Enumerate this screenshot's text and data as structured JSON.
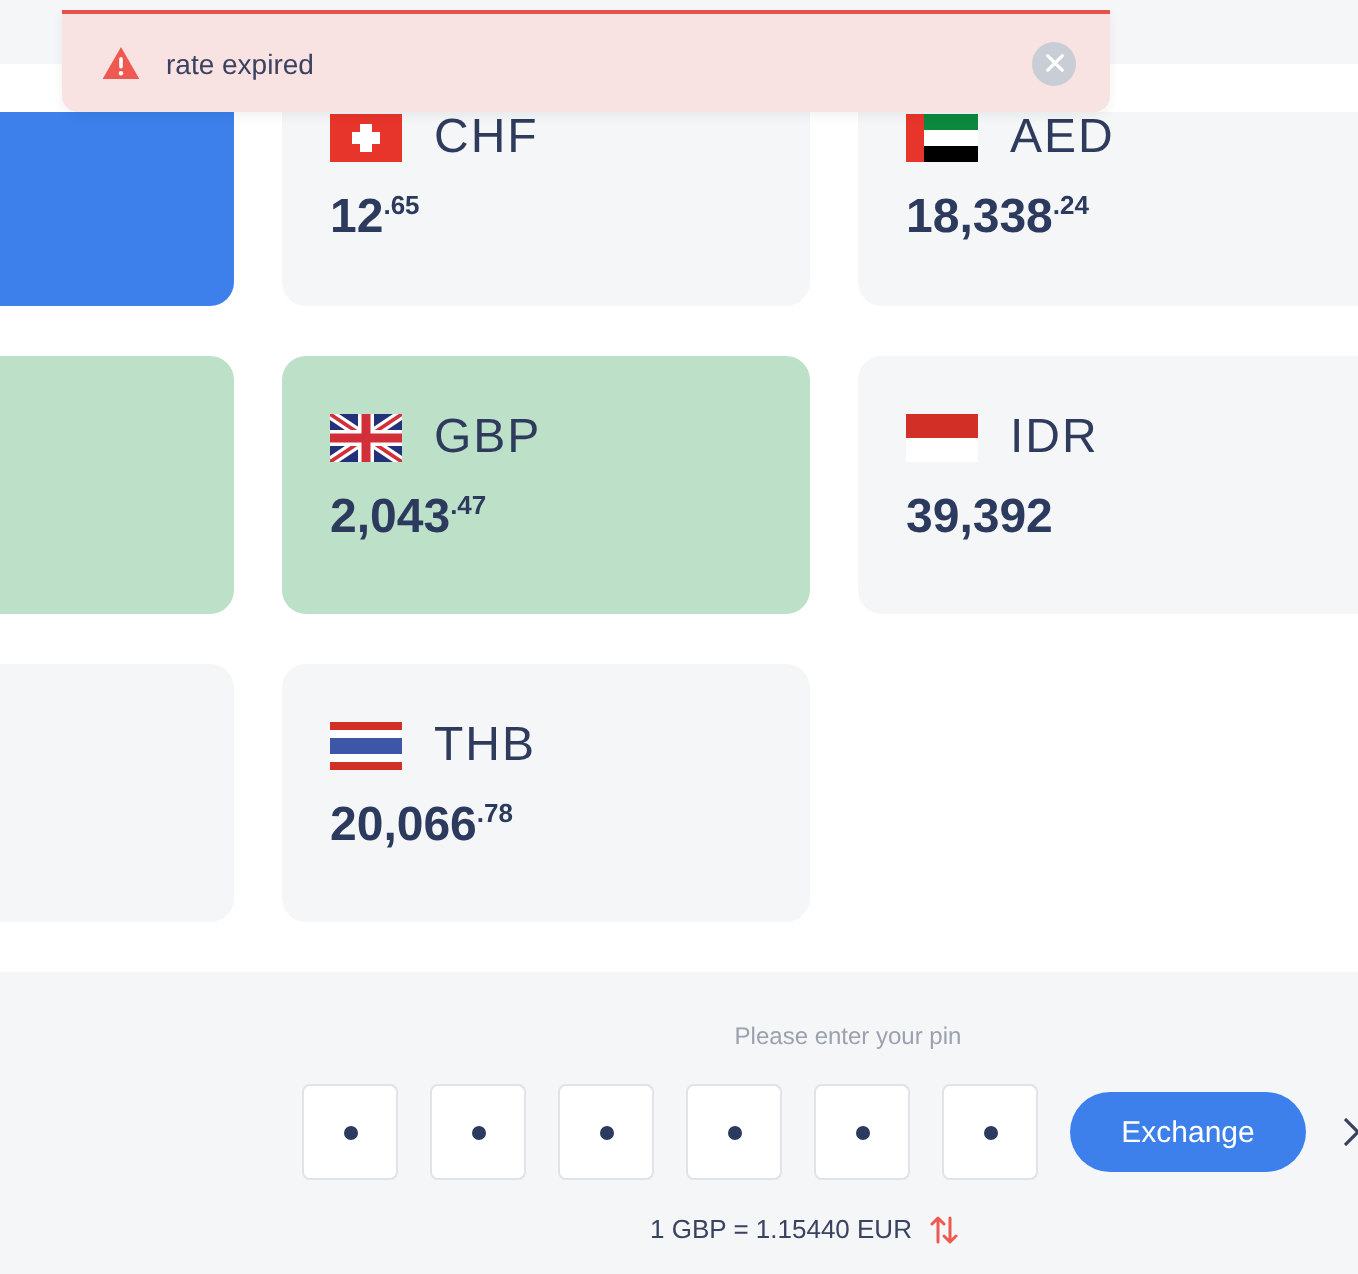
{
  "toast": {
    "kind": "error",
    "message": "rate expired"
  },
  "cards": [
    {
      "active": true,
      "selected": false
    },
    {
      "code": "CHF",
      "kind": "ch",
      "amount": "12$^{.65}$",
      "active": false,
      "selected": false
    },
    {
      "code": "AED",
      "kind": "ae",
      "amount": "18,338$^{.24}$",
      "active": false,
      "selected": false
    },
    {
      "active": false,
      "selected": true
    },
    {
      "code": "GBP",
      "kind": "gb",
      "amount": "2,043$^{.47}$",
      "active": false,
      "selected": true
    },
    {
      "code": "IDR",
      "kind": "id",
      "amount": "39,392",
      "active": false,
      "selected": false
    },
    {
      "active": false,
      "selected": false
    },
    {
      "code": "THB",
      "kind": "th",
      "amount": "20,066$^{.78}$",
      "active": false,
      "selected": false
    }
  ],
  "pin": {
    "label": "Please enter your pin",
    "digits": [
      {
        "filled": true
      },
      {
        "filled": true
      },
      {
        "filled": true
      },
      {
        "filled": true
      },
      {
        "filled": true
      },
      {
        "filled": true
      }
    ]
  },
  "exchange_button": "Exchange",
  "rate": "1 GBP = 1.15440 EUR"
}
